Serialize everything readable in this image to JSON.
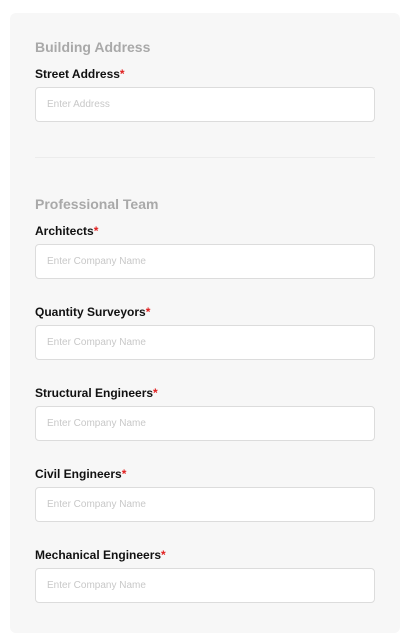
{
  "building_address": {
    "section_title": "Building Address",
    "street_address": {
      "label": "Street Address",
      "required_mark": "*",
      "value": "",
      "placeholder": "Enter Address"
    }
  },
  "professional_team": {
    "section_title": "Professional Team",
    "fields": [
      {
        "label": "Architects",
        "required_mark": "*",
        "value": "",
        "placeholder": "Enter Company Name"
      },
      {
        "label": "Quantity Surveyors",
        "required_mark": "*",
        "value": "",
        "placeholder": "Enter Company Name"
      },
      {
        "label": "Structural Engineers",
        "required_mark": "*",
        "value": "",
        "placeholder": "Enter Company Name"
      },
      {
        "label": "Civil Engineers",
        "required_mark": "*",
        "value": "",
        "placeholder": "Enter Company Name"
      },
      {
        "label": "Mechanical Engineers",
        "required_mark": "*",
        "value": "",
        "placeholder": "Enter Company Name"
      }
    ]
  },
  "colors": {
    "required": "#e02020",
    "section_title": "#a9a9a9",
    "card_background": "#f7f7f7"
  }
}
